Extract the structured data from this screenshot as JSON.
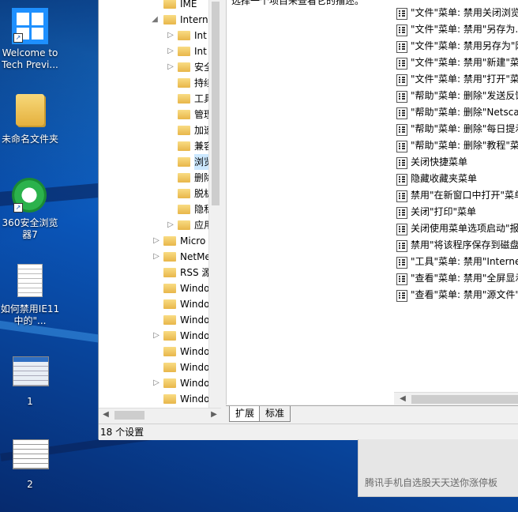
{
  "desktop": {
    "icons": [
      {
        "label": "Welcome to Tech Previ...",
        "icon": "windows-logo-icon"
      },
      {
        "label": "未命名文件夹",
        "icon": "folder-icon"
      },
      {
        "label": "360安全浏览器7",
        "icon": "browser-icon"
      },
      {
        "label": "如何禁用IE11中的\"...",
        "icon": "document-icon"
      },
      {
        "label": "1",
        "icon": "screenshot-thumbnail-icon"
      },
      {
        "label": "2",
        "icon": "screenshot-thumbnail-icon"
      }
    ]
  },
  "tree": {
    "items": [
      {
        "label": "IME",
        "arrow": ""
      },
      {
        "label": "Interne",
        "arrow": "◢"
      },
      {
        "label": "Int",
        "arrow": "▷"
      },
      {
        "label": "Int",
        "arrow": "▷"
      },
      {
        "label": "安全",
        "arrow": "▷"
      },
      {
        "label": "持续",
        "arrow": ""
      },
      {
        "label": "工具",
        "arrow": ""
      },
      {
        "label": "管理",
        "arrow": ""
      },
      {
        "label": "加速",
        "arrow": ""
      },
      {
        "label": "兼容",
        "arrow": ""
      },
      {
        "label": "浏览",
        "arrow": ""
      },
      {
        "label": "删除",
        "arrow": ""
      },
      {
        "label": "脱机",
        "arrow": ""
      },
      {
        "label": "隐私",
        "arrow": ""
      },
      {
        "label": "应用",
        "arrow": "▷"
      },
      {
        "label": "Micro",
        "arrow": "▷"
      },
      {
        "label": "NetMe",
        "arrow": "▷"
      },
      {
        "label": "RSS 源",
        "arrow": ""
      },
      {
        "label": "Windo",
        "arrow": ""
      },
      {
        "label": "Windo",
        "arrow": ""
      },
      {
        "label": "Windo",
        "arrow": ""
      },
      {
        "label": "Windo",
        "arrow": "▷"
      },
      {
        "label": "Windo",
        "arrow": ""
      },
      {
        "label": "Windo",
        "arrow": ""
      },
      {
        "label": "Windo",
        "arrow": "▷"
      },
      {
        "label": "Windo",
        "arrow": ""
      }
    ]
  },
  "right": {
    "description": "选择一个项目来查看它的描述。",
    "settings": [
      "\"文件\"菜单: 禁用关闭浏览器",
      "\"文件\"菜单: 禁用\"另存为...",
      "\"文件\"菜单: 禁用另存为\"网",
      "\"文件\"菜单: 禁用\"新建\"菜",
      "\"文件\"菜单: 禁用\"打开\"菜",
      "\"帮助\"菜单: 删除\"发送反馈",
      "\"帮助\"菜单: 删除\"Netscap",
      "\"帮助\"菜单: 删除\"每日提示",
      "\"帮助\"菜单: 删除\"教程\"菜",
      "关闭快捷菜单",
      "隐藏收藏夹菜单",
      "禁用\"在新窗口中打开\"菜单",
      "关闭\"打印\"菜单",
      "关闭使用菜单选项启动\"报",
      "禁用\"将该程序保存到磁盘",
      "\"工具\"菜单: 禁用\"Internet",
      "\"查看\"菜单: 禁用\"全屏显示",
      "\"查看\"菜单: 禁用\"源文件\""
    ]
  },
  "tabs": [
    "扩展",
    "标准"
  ],
  "status": "18 个设置",
  "notification": "腾讯手机自选股天天送你涨停板"
}
